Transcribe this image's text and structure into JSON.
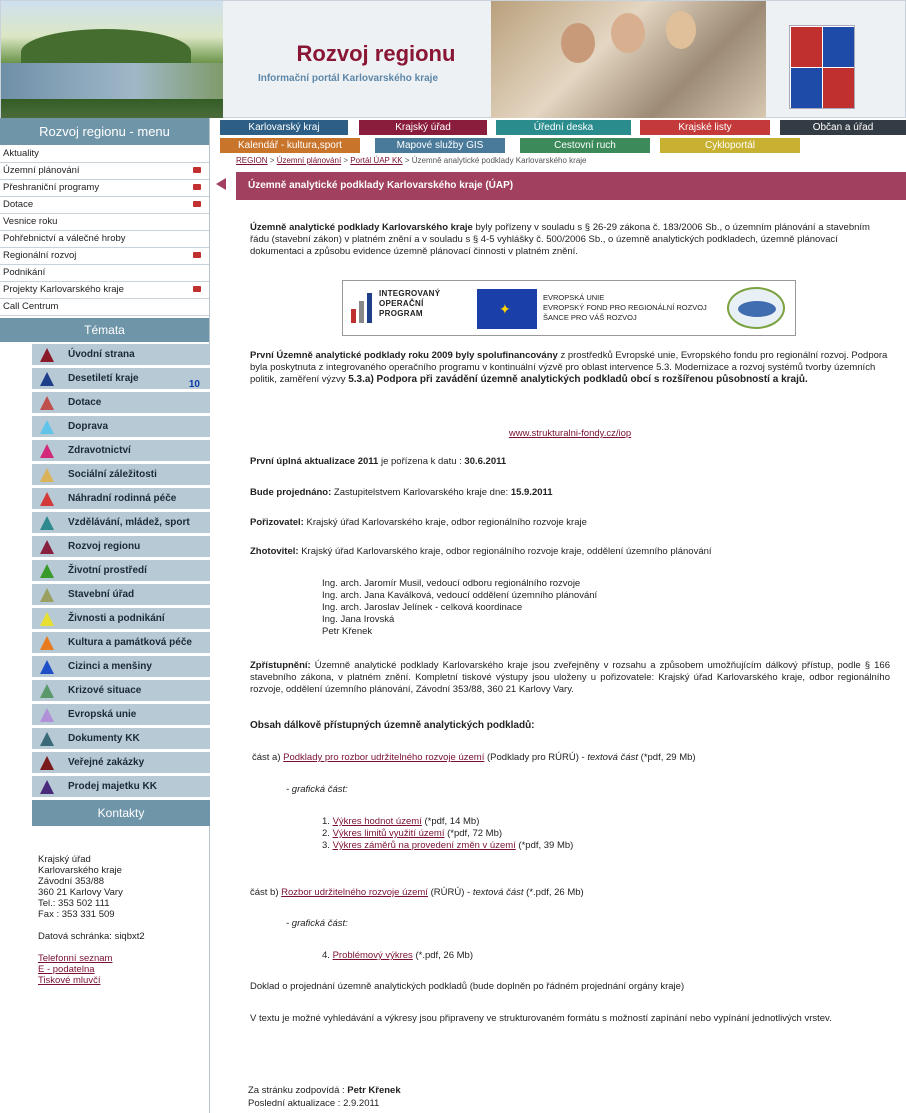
{
  "header": {
    "title": "Rozvoj regionu",
    "subtitle": "Informační portál Karlovarského kraje"
  },
  "sidebar": {
    "menu_title": "Rozvoj regionu - menu",
    "menu_items": [
      {
        "label": "Aktuality",
        "arrow": false
      },
      {
        "label": "Územní plánování",
        "arrow": true
      },
      {
        "label": "Přeshraniční programy",
        "arrow": true
      },
      {
        "label": "Dotace",
        "arrow": true
      },
      {
        "label": "Vesnice roku",
        "arrow": false
      },
      {
        "label": "Pohřebnictví a válečné hroby",
        "arrow": false
      },
      {
        "label": "Regionální rozvoj",
        "arrow": true
      },
      {
        "label": "Podnikání",
        "arrow": false
      },
      {
        "label": "Projekty Karlovarského kraje",
        "arrow": true
      },
      {
        "label": "Call Centrum",
        "arrow": false
      }
    ],
    "themes_title": "Témata",
    "themes": [
      {
        "label": "Úvodní strana",
        "color": "#8a1a2a"
      },
      {
        "label": "Desetiletí kraje",
        "color": "#203f8a",
        "badge": "10"
      },
      {
        "label": "Dotace",
        "color": "#c0504d"
      },
      {
        "label": "Doprava",
        "color": "#5fc4e8"
      },
      {
        "label": "Zdravotnictví",
        "color": "#d4287a"
      },
      {
        "label": "Sociální záležitosti",
        "color": "#d9b25a"
      },
      {
        "label": "Náhradní rodinná péče",
        "color": "#d43a3a"
      },
      {
        "label": "Vzdělávání, mládež, sport",
        "color": "#2e8a8f"
      },
      {
        "label": "Rozvoj regionu",
        "color": "#8a2040"
      },
      {
        "label": "Životní prostředí",
        "color": "#3a9a2a"
      },
      {
        "label": "Stavební úřad",
        "color": "#9aa060"
      },
      {
        "label": "Živnosti a podnikání",
        "color": "#e8e030"
      },
      {
        "label": "Kultura a památková péče",
        "color": "#e87a20"
      },
      {
        "label": "Cizinci a menšiny",
        "color": "#2050c8"
      },
      {
        "label": "Krizové situace",
        "color": "#5a9a6a"
      },
      {
        "label": "Evropská unie",
        "color": "#b090d8"
      },
      {
        "label": "Dokumenty KK",
        "color": "#3a6a7a"
      },
      {
        "label": "Veřejné zakázky",
        "color": "#7a1a1a"
      },
      {
        "label": "Prodej majetku KK",
        "color": "#4a2a7a"
      }
    ],
    "contacts_title": "Kontakty",
    "contact": {
      "line1": "Krajský úřad",
      "line2": "Karlovarského kraje",
      "line3": "Závodní 353/88",
      "line4": "360 21 Karlovy Vary",
      "tel": "Tel.: 353 502 111",
      "fax": "Fax : 353 331 509",
      "datova": "Datová schránka: siqbxt2",
      "link1": "Telefonní seznam",
      "link2": "E - podatelna",
      "link3": "Tiskové mluvčí"
    }
  },
  "nav": {
    "tabs_row1": [
      {
        "label": "Karlovarský kraj",
        "color": "#2d5f86"
      },
      {
        "label": "Krajský úřad",
        "color": "#8a1d3c"
      },
      {
        "label": "Úřední deska",
        "color": "#2a8c8c"
      },
      {
        "label": "Krajské listy",
        "color": "#c43a3a"
      },
      {
        "label": "Občan a úřad",
        "color": "#333b44"
      }
    ],
    "tabs_row2": [
      {
        "label": "Kalendář - kultura,sport",
        "color": "#c8742a"
      },
      {
        "label": "Mapové služby GIS",
        "color": "#4a7a9a"
      },
      {
        "label": "Cestovní ruch",
        "color": "#3c8a5a"
      },
      {
        "label": "Cykloportál",
        "color": "#c8b030"
      }
    ]
  },
  "breadcrumb": {
    "items": [
      "REGION",
      "Územní plánování",
      "Portál ÚAP KK"
    ],
    "current": "Územně analytické podklady Karlovarského kraje"
  },
  "page": {
    "title": "Územně analytické podklady Karlovarského kraje (ÚAP)",
    "intro_bold": "Územně analytické podklady Karlovarského kraje",
    "intro_text": " byly pořízeny v souladu s § 26-29 zákona č. 183/2006 Sb., o územním plánování a stavebním řádu (stavební zákon) v platném znění a v souladu s § 4-5 vyhlášky č. 500/2006 Sb., o územně analytických podkladech, územně plánovací dokumentaci a způsobu evidence územně plánovací činnosti v platném znění.",
    "logos": {
      "iop_line1": "INTEGROVANÝ",
      "iop_line2": "OPERAČNÍ",
      "iop_line3": "PROGRAM",
      "eu_line1": "EVROPSKÁ UNIE",
      "eu_line2": "EVROPSKÝ FOND PRO REGIONÁLNÍ ROZVOJ",
      "eu_line3": "ŠANCE PRO VÁŠ ROZVOJ"
    },
    "funding_bold": "První Územně analytické podklady roku 2009 byly spolufinancovány",
    "funding_text": " z prostředků Evropské unie, Evropského fondu pro regionální rozvoj. Podpora byla poskytnuta z integrovaného operačního programu v kontinuální výzvě pro oblast intervence 5.3. Modernizace a rozvoj systémů tvorby územních politik, zaměření výzvy ",
    "funding_bold2": "5.3.a) Podpora při zavádění územně analytických podkladů obcí s rozšířenou působností a krajů.",
    "link_iop": "www.strukturalni-fondy.cz/iop",
    "update_label": "První úplná aktualizace 2011",
    "update_text": " je pořízena k datu : ",
    "update_date": "30.6.2011",
    "discuss_label": "Bude projednáno:",
    "discuss_text": "  Zastupitelstvem Karlovarského kraje dne: ",
    "discuss_date": "15.9.2011",
    "porizovatel_label": "Pořizovatel:",
    "porizovatel_text": "  Krajský úřad Karlovarského kraje, odbor regionálního rozvoje kraje",
    "zhotovitel_label": "Zhotovitel:",
    "zhotovitel_text": "  Krajský úřad Karlovarského kraje, odbor regionálního rozvoje kraje, oddělení územního plánování",
    "team": [
      "Ing. arch. Jaromír Musil, vedoucí odboru regionálního rozvoje",
      "Ing. arch. Jana Kaválková, vedoucí oddělení územního plánování",
      "Ing. arch. Jaroslav Jelínek - celková koordinace",
      "Ing. Jana Irovská",
      "Petr Křenek"
    ],
    "access_label": "Zpřístupnění:",
    "access_text": "  Územně analytické podklady Karlovarského kraje jsou zveřejněny v rozsahu a způsobem umožňujícím dálkový přístup, podle § 166 stavebního zákona, v platném znění. Kompletní tiskové výstupy jsou uloženy u pořizovatele: Krajský úřad Karlovarského kraje, odbor regionálního rozvoje, oddělení územního plánování, Závodní 353/88, 360 21 Karlovy Vary.",
    "contents_title": "Obsah dálkově přístupných územně analytických podkladů:",
    "part_a_prefix": "část a) ",
    "part_a_link": "Podklady pro rozbor udržitelného rozvoje území",
    "part_a_mid": " (Podklady pro RÚRÚ) - ",
    "part_a_textual": "textová část",
    "part_a_size": " (*pdf, 29 Mb)",
    "graphic_part": "- grafická část:",
    "drawings_a": [
      {
        "num": "1. ",
        "link": "Výkres hodnot území",
        "size": " (*pdf, 14 Mb)"
      },
      {
        "num": "2. ",
        "link": "Výkres limitů využití území",
        "size": " (*pdf, 72 Mb)"
      },
      {
        "num": "3. ",
        "link": "Výkres záměrů na provedení změn v území",
        "size": " (*pdf, 39 Mb)"
      }
    ],
    "part_b_prefix": "část b) ",
    "part_b_link": "Rozbor udržitelného rozvoje území",
    "part_b_mid": " (RÚRÚ) - ",
    "part_b_textual": "textová část",
    "part_b_size": " (*.pdf, 26 Mb)",
    "drawing_b": {
      "num": "4. ",
      "link": "Problémový výkres",
      "size": " (*.pdf, 26 Mb)"
    },
    "note1": "Doklad o projednání územně analytických podkladů (bude doplněn po řádném projednání orgány kraje)",
    "note2": "V textu je možné vyhledávání a výkresy jsou připraveny ve strukturovaném formátu s možností zapínání nebo vypínání jednotlivých vrstev.",
    "responsible_label": "Za stránku zodpovídá : ",
    "responsible_name": "Petr Křenek",
    "updated_label": "Poslední aktualizace : ",
    "updated_date": "2.9.2011"
  }
}
